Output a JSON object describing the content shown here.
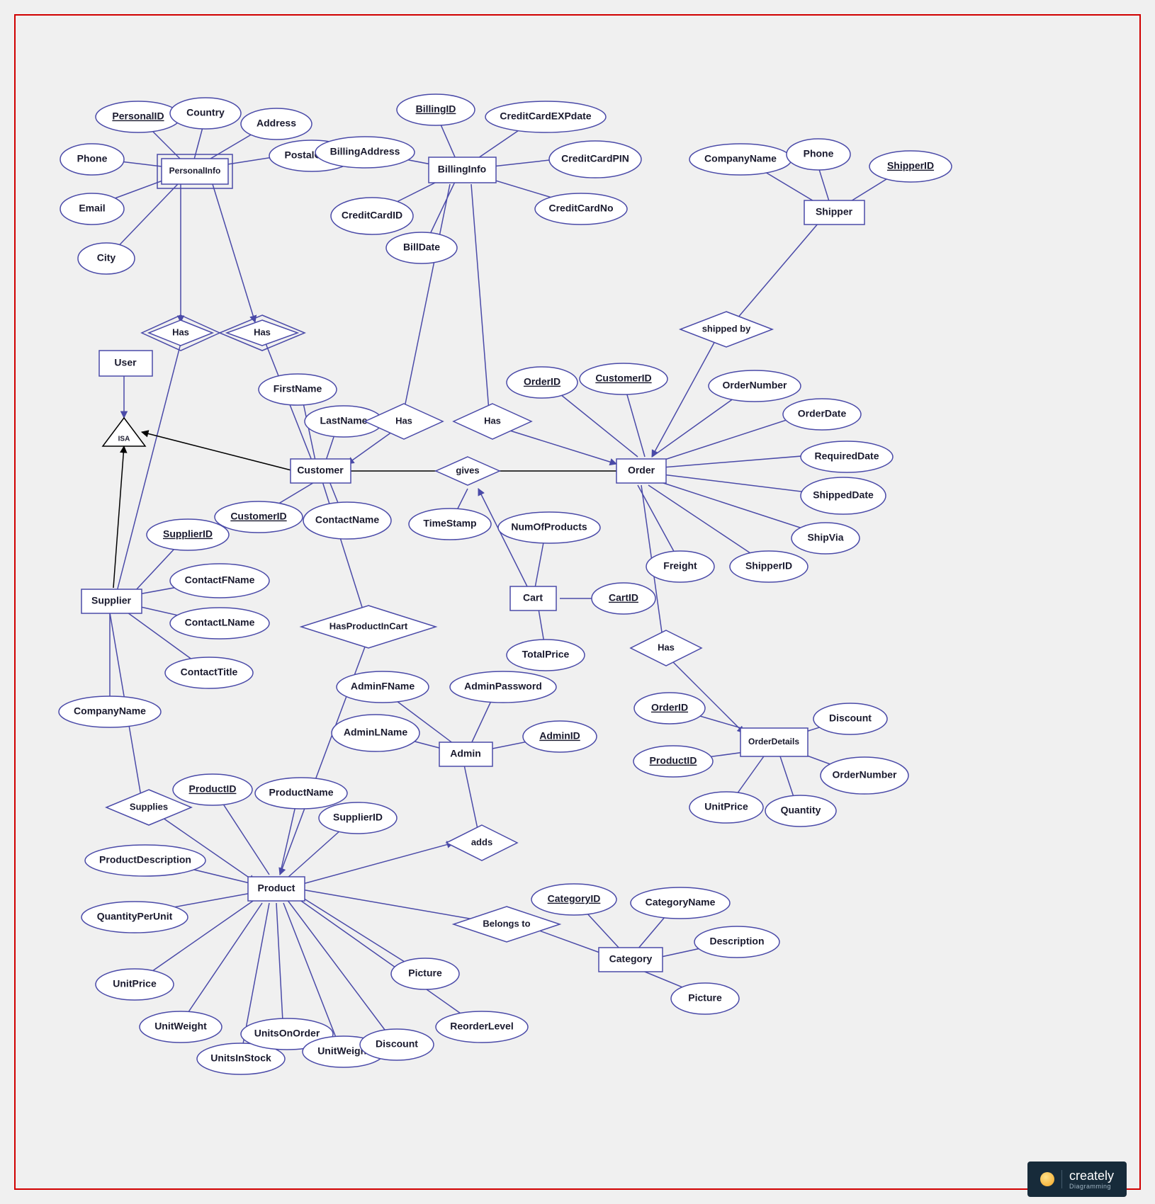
{
  "branding": {
    "name": "creately",
    "tagline": "Diagramming"
  },
  "entities": {
    "user": "User",
    "personalinfo": "PersonalInfo",
    "billinginfo": "BillingInfo",
    "shipper": "Shipper",
    "customer": "Customer",
    "order": "Order",
    "cart": "Cart",
    "supplier": "Supplier",
    "admin": "Admin",
    "product": "Product",
    "orderdetails": "OrderDetails",
    "category": "Category"
  },
  "relationships": {
    "has1": "Has",
    "has2": "Has",
    "has3": "Has",
    "has4": "Has",
    "shippedby": "shipped by",
    "gives": "gives",
    "hasproductincart": "HasProductInCart",
    "hasOD": "Has",
    "supplies": "Supplies",
    "adds": "adds",
    "belongsto": "Belongs to",
    "isa": "ISA"
  },
  "attrs": {
    "personalinfo": {
      "PersonalID": "PersonalID",
      "Country": "Country",
      "Address": "Address",
      "PostalCode": "PostalCode",
      "Phone": "Phone",
      "Email": "Email",
      "City": "City"
    },
    "billinginfo": {
      "BillingID": "BillingID",
      "BillingAddress": "BillingAddress",
      "CreditCardEXPdate": "CreditCardEXPdate",
      "CreditCardPIN": "CreditCardPIN",
      "CreditCardNo": "CreditCardNo",
      "CreditCardID": "CreditCardID",
      "BillDate": "BillDate"
    },
    "shipper": {
      "CompanyName": "CompanyName",
      "Phone": "Phone",
      "ShipperID": "ShipperID"
    },
    "customer": {
      "FirstName": "FirstName",
      "LastName": "LastName",
      "ContactName": "ContactName",
      "CustomerID": "CustomerID"
    },
    "order": {
      "OrderID": "OrderID",
      "CustomerID": "CustomerID",
      "OrderNumber": "OrderNumber",
      "OrderDate": "OrderDate",
      "RequiredDate": "RequiredDate",
      "ShippedDate": "ShippedDate",
      "ShipVia": "ShipVia",
      "ShipperID": "ShipperID",
      "Freight": "Freight"
    },
    "cart": {
      "NumOfProducts": "NumOfProducts",
      "CartID": "CartID",
      "TotalPrice": "TotalPrice",
      "TimeStamp": "TimeStamp"
    },
    "supplier": {
      "SupplierID": "SupplierID",
      "ContactFName": "ContactFName",
      "ContactLName": "ContactLName",
      "ContactTitle": "ContactTitle",
      "CompanyName": "CompanyName"
    },
    "admin": {
      "AdminFName": "AdminFName",
      "AdminLName": "AdminLName",
      "AdminPassword": "AdminPassword",
      "AdminID": "AdminID"
    },
    "product": {
      "ProductID": "ProductID",
      "ProductName": "ProductName",
      "SupplierID": "SupplierID",
      "ProductDescription": "ProductDescription",
      "QuantityPerUnit": "QuantityPerUnit",
      "UnitPrice": "UnitPrice",
      "UnitWeight": "UnitWeight",
      "UnitsInStock": "UnitsInStock",
      "UnitsOnOrder": "UnitsOnOrder",
      "UnitWeight2": "UnitWeight",
      "Discount": "Discount",
      "ReorderLevel": "ReorderLevel",
      "Picture": "Picture"
    },
    "orderdetails": {
      "OrderID": "OrderID",
      "ProductID": "ProductID",
      "Discount": "Discount",
      "OrderNumber": "OrderNumber",
      "UnitPrice": "UnitPrice",
      "Quantity": "Quantity"
    },
    "category": {
      "CategoryID": "CategoryID",
      "CategoryName": "CategoryName",
      "Description": "Description",
      "Picture": "Picture"
    }
  }
}
